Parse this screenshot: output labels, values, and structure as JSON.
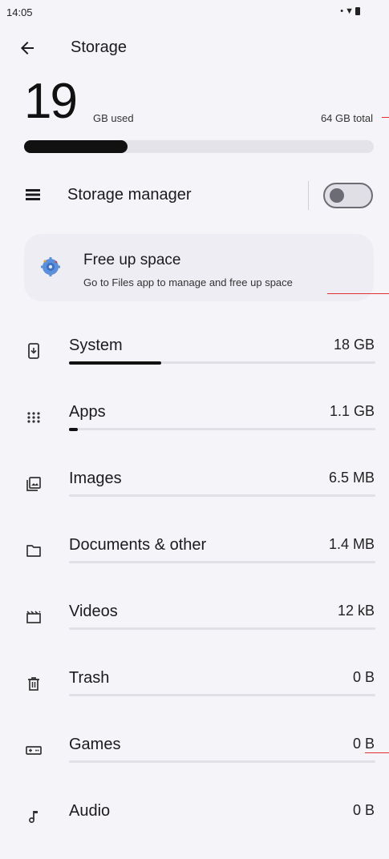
{
  "status_bar": {
    "time": "14:05"
  },
  "app_bar": {
    "title": "Storage"
  },
  "summary": {
    "used_value": "19",
    "used_unit": "GB used",
    "total": "64 GB total",
    "used_fraction": 0.297
  },
  "storage_manager": {
    "label": "Storage manager",
    "enabled": false
  },
  "free_up": {
    "title": "Free up space",
    "subtitle": "Go to Files app to manage and free up space"
  },
  "categories": [
    {
      "label": "System",
      "value": "18 GB",
      "icon": "system-icon",
      "fraction": 0.3
    },
    {
      "label": "Apps",
      "value": "1.1 GB",
      "icon": "apps-grid-icon",
      "fraction": 0.03
    },
    {
      "label": "Images",
      "value": "6.5 MB",
      "icon": "images-icon",
      "fraction": 0
    },
    {
      "label": "Documents & other",
      "value": "1.4 MB",
      "icon": "folder-icon",
      "fraction": 0
    },
    {
      "label": "Videos",
      "value": "12 kB",
      "icon": "video-icon",
      "fraction": 0
    },
    {
      "label": "Trash",
      "value": "0 B",
      "icon": "trash-icon",
      "fraction": 0
    },
    {
      "label": "Games",
      "value": "0 B",
      "icon": "gamepad-icon",
      "fraction": 0
    },
    {
      "label": "Audio",
      "value": "0 B",
      "icon": "music-note-icon",
      "fraction": 0
    }
  ]
}
